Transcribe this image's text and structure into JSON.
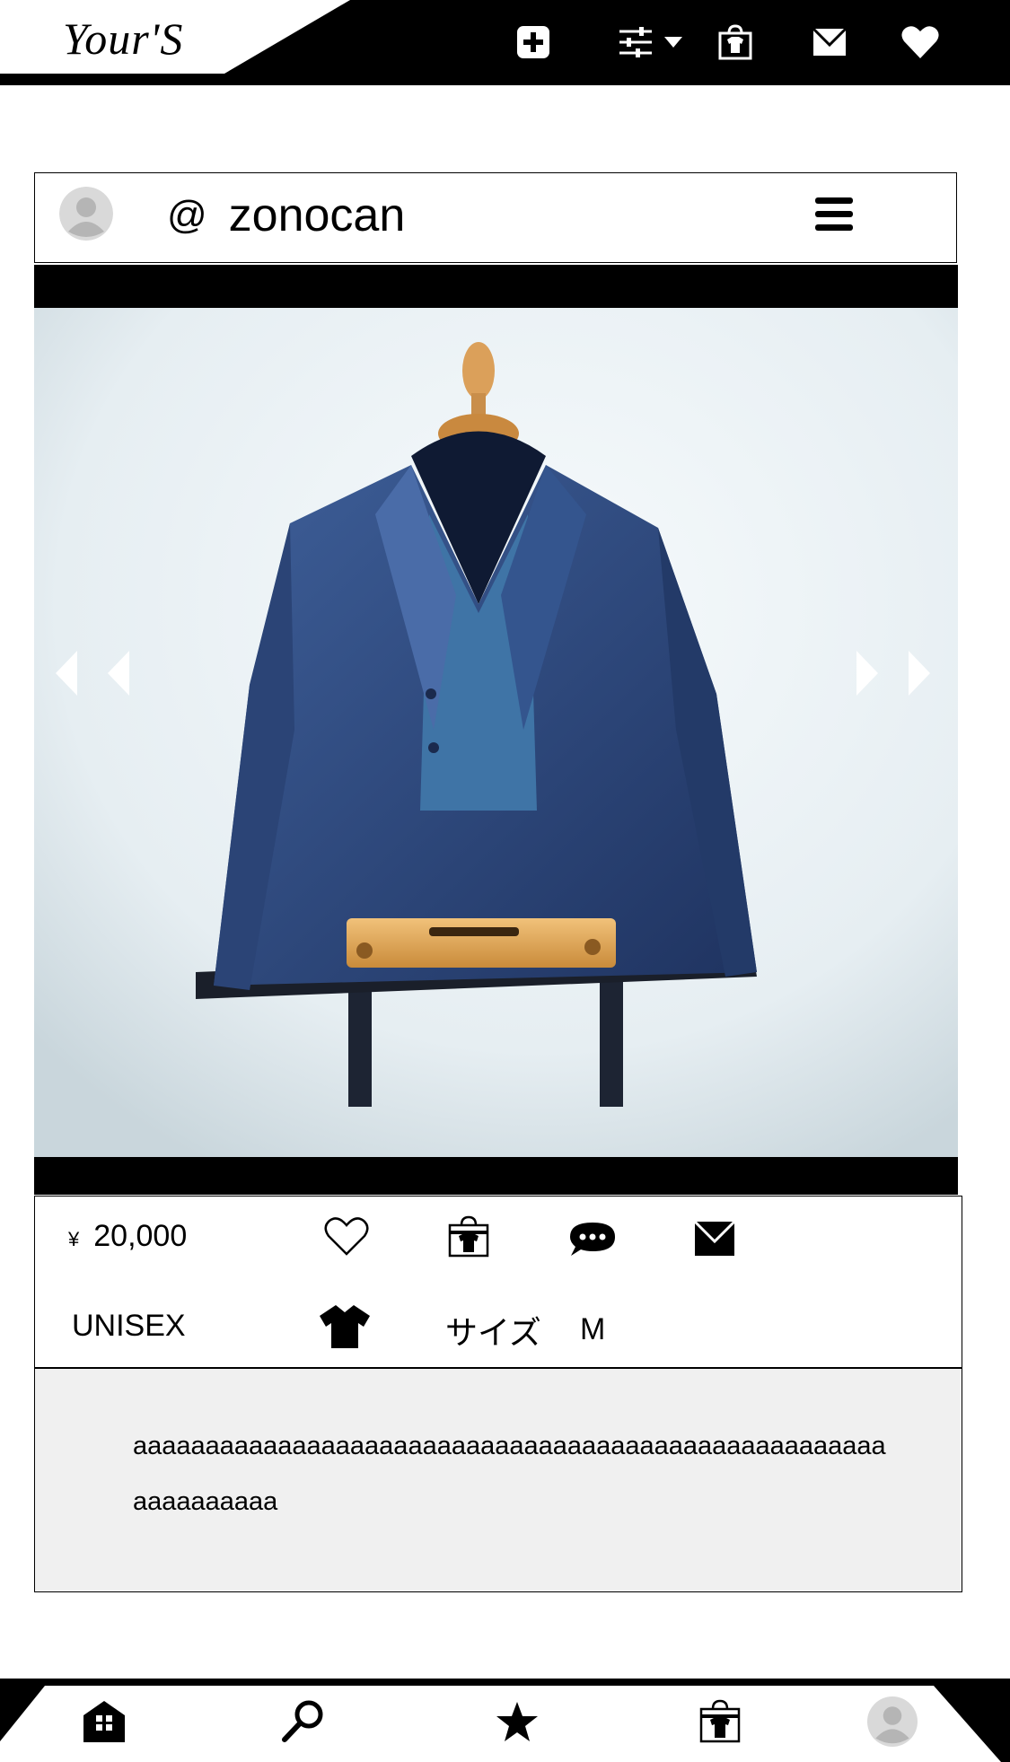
{
  "app": {
    "logo": "Your'S"
  },
  "header_icons": [
    "add-post-icon",
    "filter-sliders-icon",
    "shop-bag-icon",
    "mail-icon",
    "heart-icon"
  ],
  "post": {
    "at_symbol": "@",
    "username": "zonocan",
    "price_symbol": "¥",
    "price": "20,000",
    "gender": "UNISEX",
    "size_label": "サイズ",
    "size_value": "M",
    "description": "aaaaaaaaaaaaaaaaaaaaaaaaaaaaaaaaaaaaaaaaaaaaaaaaaaaaaaaaaaaaaa"
  },
  "info_icons": [
    "like-heart-icon",
    "shop-bag-icon",
    "comment-bubble-icon",
    "message-mail-icon",
    "shirt-category-icon"
  ],
  "bottom_nav": [
    "home-icon",
    "search-icon",
    "favorites-star-icon",
    "shop-bag-icon",
    "profile-avatar-icon"
  ],
  "colors": {
    "bar": "#000000",
    "description_bg": "#f0f0f0",
    "suit": "#2f4a7e",
    "wall": "#eef3f6"
  }
}
